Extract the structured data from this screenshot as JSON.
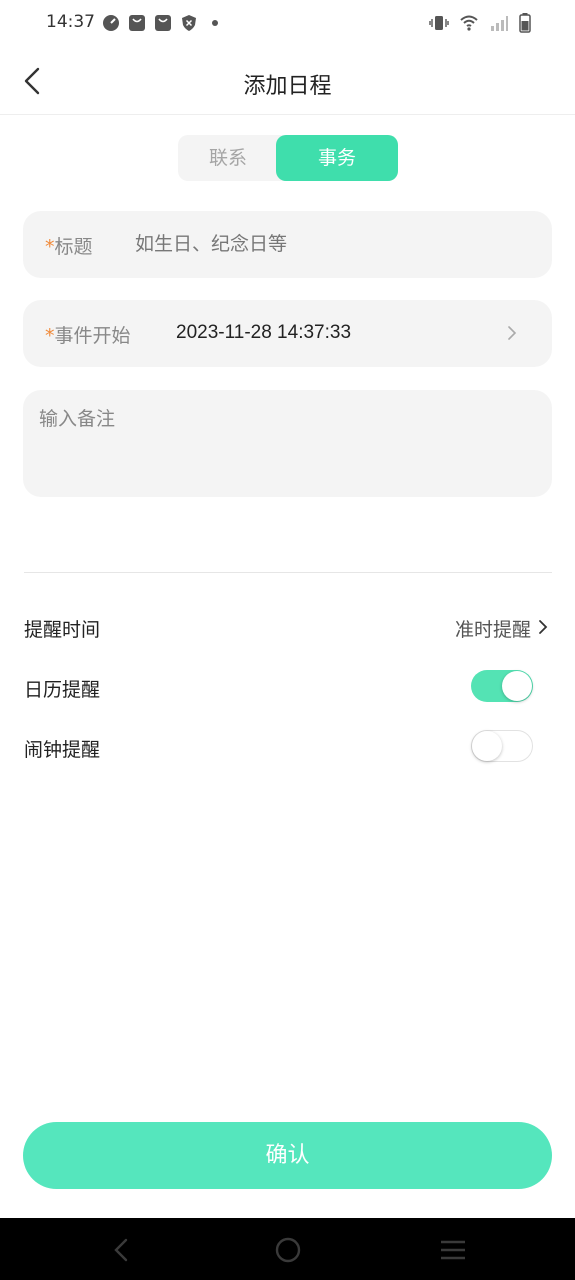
{
  "status_bar": {
    "time": "14:37"
  },
  "header": {
    "title": "添加日程"
  },
  "segment": {
    "contact_label": "联系",
    "affair_label": "事务",
    "selected": "事务"
  },
  "form": {
    "required_mark": "*",
    "title_label": "标题",
    "title_placeholder": "如生日、纪念日等",
    "start_label": "事件开始",
    "start_value": "2023-11-28 14:37:33",
    "note_placeholder": "输入备注"
  },
  "settings": {
    "remind_time_label": "提醒时间",
    "remind_time_value": "准时提醒",
    "calendar_label": "日历提醒",
    "calendar_on": true,
    "alarm_label": "闹钟提醒",
    "alarm_on": false
  },
  "confirm": {
    "label": "确认"
  },
  "colors": {
    "accent": "#3fdeac",
    "confirm": "#55e6bd",
    "required": "#f08a3a"
  }
}
